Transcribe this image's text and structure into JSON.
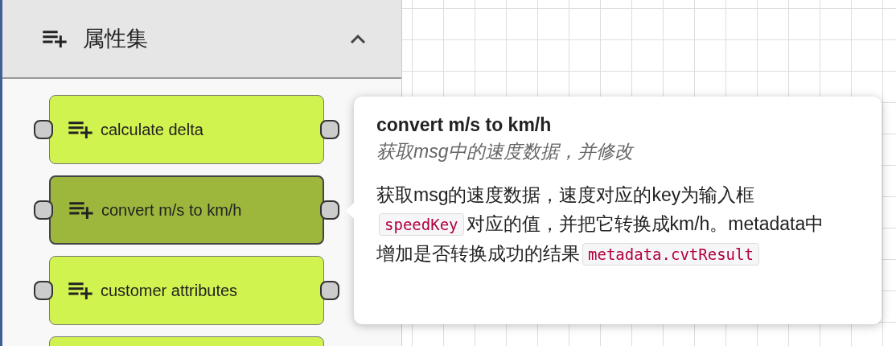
{
  "panel": {
    "title": "属性集",
    "expanded": true,
    "nodes": [
      {
        "label": "calculate delta",
        "selected": false
      },
      {
        "label": "convert m/s to km/h",
        "selected": true
      },
      {
        "label": "customer attributes",
        "selected": false
      },
      {
        "selected": false
      }
    ]
  },
  "tooltip": {
    "title": "convert m/s to km/h",
    "subtitle": "获取msg中的速度数据，并修改",
    "description": [
      {
        "kind": "text",
        "text": "获取msg的速度数据，速度对应的key为输入框"
      },
      {
        "kind": "code",
        "text": "speedKey"
      },
      {
        "kind": "text",
        "text": "对应的值，并把它转换成km/h。metadata中增加是否转换成功的结果"
      },
      {
        "kind": "code",
        "text": "metadata.cvtResult"
      }
    ]
  }
}
